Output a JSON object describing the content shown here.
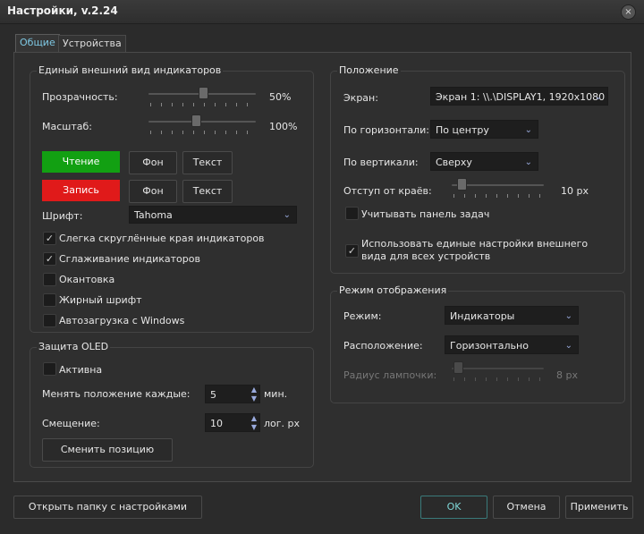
{
  "window": {
    "title": "Настройки, v.2.24"
  },
  "tabs": [
    {
      "label": "Общие"
    },
    {
      "label": "Устройства"
    }
  ],
  "appearance": {
    "title": "Единый внешний вид индикаторов",
    "opacity_label": "Прозрачность:",
    "opacity_value": "50%",
    "opacity_level": 0.5,
    "scale_label": "Масштаб:",
    "scale_value": "100%",
    "scale_level": 0.45,
    "read_label": "Чтение",
    "read_color": "#12a012",
    "write_label": "Запись",
    "write_color": "#e01a1a",
    "bg_label": "Фон",
    "text_label": "Текст",
    "font_label": "Шрифт:",
    "font_value": "Tahoma",
    "checks": [
      {
        "label": "Слегка скруглённые края индикаторов",
        "checked": true
      },
      {
        "label": "Сглаживание индикаторов",
        "checked": true
      },
      {
        "label": "Окантовка",
        "checked": false
      },
      {
        "label": "Жирный шрифт",
        "checked": false
      },
      {
        "label": "Автозагрузка с Windows",
        "checked": false
      }
    ]
  },
  "oled": {
    "title": "Защита OLED",
    "active_label": "Активна",
    "active_checked": false,
    "interval_label": "Менять положение каждые:",
    "interval_value": "5",
    "interval_unit": "мин.",
    "offset_label": "Смещение:",
    "offset_value": "10",
    "offset_unit": "лог. px",
    "change_button": "Сменить позицию"
  },
  "position": {
    "title": "Положение",
    "screen_label": "Экран:",
    "screen_value": "Экран 1: \\\\.\\DISPLAY1, 1920x1080",
    "horizontal_label": "По горизонтали:",
    "horizontal_value": "По центру",
    "vertical_label": "По вертикали:",
    "vertical_value": "Сверху",
    "margin_label": "Отступ от краёв:",
    "margin_value": "10 px",
    "margin_level": 0.05,
    "taskbar_label": "Учитывать панель задач",
    "taskbar_checked": false,
    "unified_label_1": "Использовать единые настройки внешнего",
    "unified_label_2": "вида для всех устройств",
    "unified_checked": true
  },
  "display": {
    "title": "Режим отображения",
    "mode_label": "Режим:",
    "mode_value": "Индикаторы",
    "layout_label": "Расположение:",
    "layout_value": "Горизонтально",
    "radius_label": "Радиус лампочки:",
    "radius_value": "8 px",
    "radius_level": 0.05
  },
  "footer": {
    "open_folder": "Открыть папку с настройками",
    "ok": "OK",
    "cancel": "Отмена",
    "apply": "Применить"
  },
  "icons": {
    "close": "close-icon",
    "dropdown": "chevron-down-icon",
    "check": "checkmark-icon",
    "spin": "spin-arrows-icon"
  }
}
